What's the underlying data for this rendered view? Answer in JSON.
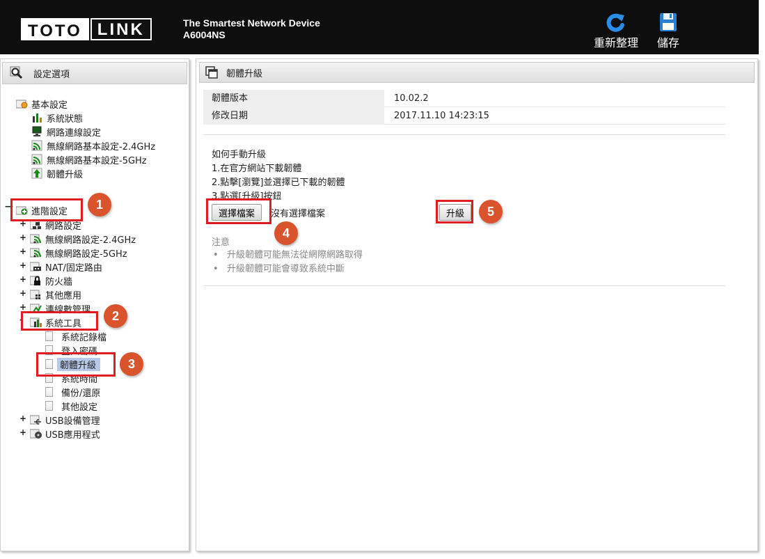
{
  "header": {
    "logo_left": "TOTO",
    "logo_right": "LINK",
    "tagline": "The Smartest Network Device",
    "model": "A6004NS",
    "refresh_label": "重新整理",
    "save_label": "儲存"
  },
  "sidebar": {
    "title": "設定選項",
    "basic": {
      "label": "基本設定",
      "items": [
        "系統狀態",
        "網路連線設定",
        "無線網路基本設定-2.4GHz",
        "無線網路基本設定-5GHz",
        "韌體升級"
      ]
    },
    "advanced": {
      "label": "進階設定",
      "items": [
        "網路設定",
        "無線網路設定-2.4GHz",
        "無線網路設定-5GHz",
        "NAT/固定路由",
        "防火牆",
        "其他應用",
        "連線數管理"
      ],
      "tools": {
        "label": "系統工具",
        "items": [
          "系統記錄檔",
          "登入密碼",
          "韌體升級",
          "系統時間",
          "備份/還原",
          "其他設定"
        ]
      },
      "after": [
        "USB設備管理",
        "USB應用程式"
      ]
    }
  },
  "main": {
    "title": "韌體升級",
    "fw_version_label": "韌體版本",
    "fw_version": "10.02.2",
    "modified_label": "修改日期",
    "modified": "2017.11.10 14:23:15",
    "howto_title": "如何手動升級",
    "step1": "1.在官方網站下載韌體",
    "step2": "2.點擊[瀏覽]並選擇已下載的韌體",
    "step3": "3.點選[升級]按鈕",
    "choose_file": "選擇檔案",
    "no_file": "沒有選擇檔案",
    "upgrade": "升級",
    "note_title": "注意",
    "notes": [
      "升級韌體可能無法從網際網路取得",
      "升級韌體可能會導致系統中斷"
    ]
  },
  "badges": [
    "1",
    "2",
    "3",
    "4",
    "5"
  ],
  "colors": {
    "highlight": "#e01b24",
    "badge": "#d9542c",
    "selected": "#b8c8e8",
    "header": "#0e0e0e"
  }
}
